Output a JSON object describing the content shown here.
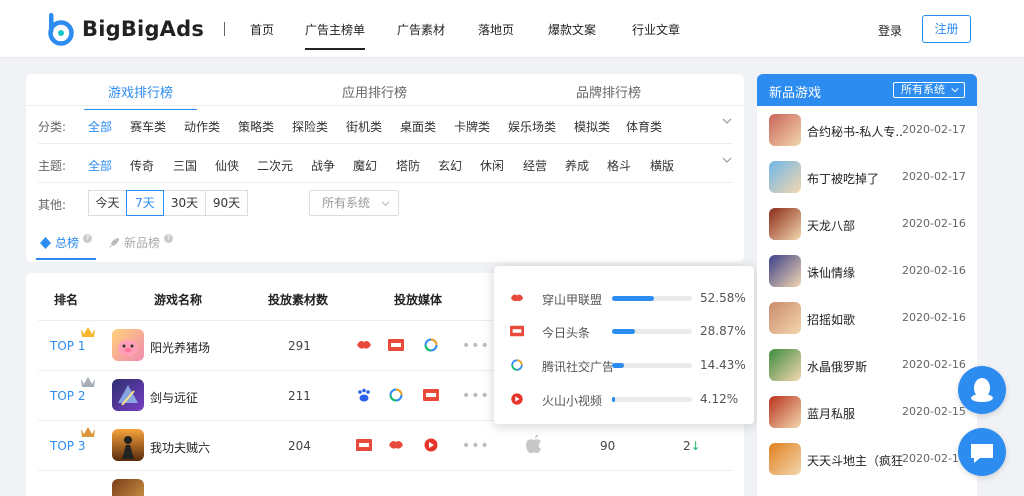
{
  "brand": {
    "name": "BigBigAds"
  },
  "nav": {
    "items": [
      "首页",
      "广告主榜单",
      "广告素材",
      "落地页",
      "爆款文案",
      "行业文章"
    ],
    "active_index": 1,
    "login": "登录",
    "register": "注册"
  },
  "filter": {
    "tabs": [
      "游戏排行榜",
      "应用排行榜",
      "品牌排行榜"
    ],
    "active_tab": 0,
    "category_label": "分类:",
    "categories": [
      "全部",
      "赛车类",
      "动作类",
      "策略类",
      "探险类",
      "街机类",
      "桌面类",
      "卡牌类",
      "娱乐场类",
      "模拟类",
      "体育类"
    ],
    "theme_label": "主题:",
    "themes": [
      "全部",
      "传奇",
      "三国",
      "仙侠",
      "二次元",
      "战争",
      "魔幻",
      "塔防",
      "玄幻",
      "休闲",
      "经营",
      "养成",
      "格斗",
      "横版"
    ],
    "other_label": "其他:",
    "periods": [
      "今天",
      "7天",
      "30天",
      "90天"
    ],
    "active_period": 1,
    "os_select": "所有系统",
    "subtabs": [
      "总榜",
      "新品榜"
    ],
    "subtab_help": "?"
  },
  "table": {
    "headers": [
      "排名",
      "游戏名称",
      "投放素材数",
      "投放媒体"
    ],
    "rows": [
      {
        "rank": "TOP 1",
        "name": "阳光养猪场",
        "count": "291",
        "media": [
          "juliang",
          "toutiao",
          "tencent"
        ],
        "more": "•••",
        "val": "",
        "trend": ""
      },
      {
        "rank": "TOP 2",
        "name": "剑与远征",
        "count": "211",
        "media": [
          "baidu",
          "tencent",
          "toutiao"
        ],
        "more": "•••",
        "val": "",
        "trend": ""
      },
      {
        "rank": "TOP 3",
        "name": "我功夫贼六",
        "count": "204",
        "media": [
          "toutiao",
          "juliang",
          "huoshan"
        ],
        "more": "•••",
        "val": "90",
        "trend": "2",
        "trend_arrow": "↓"
      }
    ]
  },
  "popup": {
    "rows": [
      {
        "name": "穿山甲联盟",
        "pct": "52.58%",
        "value": 0.5258,
        "icon": "juliang"
      },
      {
        "name": "今日头条",
        "pct": "28.87%",
        "value": 0.2887,
        "icon": "toutiao"
      },
      {
        "name": "腾讯社交广告",
        "pct": "14.43%",
        "value": 0.1443,
        "icon": "tencent"
      },
      {
        "name": "火山小视频",
        "pct": "4.12%",
        "value": 0.0412,
        "icon": "huoshan"
      }
    ]
  },
  "side": {
    "title": "新品游戏",
    "os": "所有系统",
    "items": [
      {
        "name": "合约秘书-私人专...",
        "date": "2020-02-17",
        "color": "#c9655a"
      },
      {
        "name": "布丁被吃掉了",
        "date": "2020-02-17",
        "color": "#6fb6e6"
      },
      {
        "name": "天龙八部",
        "date": "2020-02-16",
        "color": "#8b2a18"
      },
      {
        "name": "诛仙情缘",
        "date": "2020-02-16",
        "color": "#3a3f8a"
      },
      {
        "name": "招摇如歌",
        "date": "2020-02-16",
        "color": "#c98b6a"
      },
      {
        "name": "水晶俄罗斯",
        "date": "2020-02-16",
        "color": "#3c8c3f"
      },
      {
        "name": "蓝月私服",
        "date": "2020-02-15",
        "color": "#b7321c"
      },
      {
        "name": "天天斗地主（疯狂...",
        "date": "2020-02-14",
        "color": "#e0801e"
      }
    ]
  },
  "colors": {
    "accent": "#2d8cf0",
    "down": "#19be6b"
  }
}
